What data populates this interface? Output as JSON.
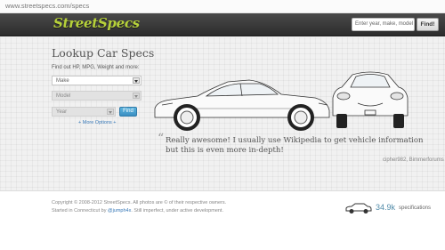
{
  "browser": {
    "url": "www.streetspecs.com/specs"
  },
  "header": {
    "logo": "StreetSpecs",
    "search_placeholder": "Enter year, make, model",
    "find_label": "Find!"
  },
  "lookup": {
    "title": "Lookup Car Specs",
    "subtitle": "Find out HP, MPG, Weight and more:",
    "make_value": "Make",
    "model_value": "Model",
    "year_value": "Year",
    "find_label": "Find",
    "more_options": "+ More Options +"
  },
  "testimonial": {
    "quote": "Really awesome! I usually use Wikipedia to get vehicle information but this is even more in-depth!",
    "author": "cipher982, Bimmerforums"
  },
  "footer": {
    "copyright": "Copyright © 2008-2012 StreetSpecs. All photos are © of their respective owners.",
    "started_prefix": "Started in Connecticut by ",
    "handle": "@jumph4x",
    "started_suffix": ". Still imperfect, under active development.",
    "spec_count": "34.9k",
    "spec_label": "specifications"
  },
  "colors": {
    "brand": "#b6d13a",
    "accent": "#3a8fc2",
    "header_bg": "#333333"
  }
}
